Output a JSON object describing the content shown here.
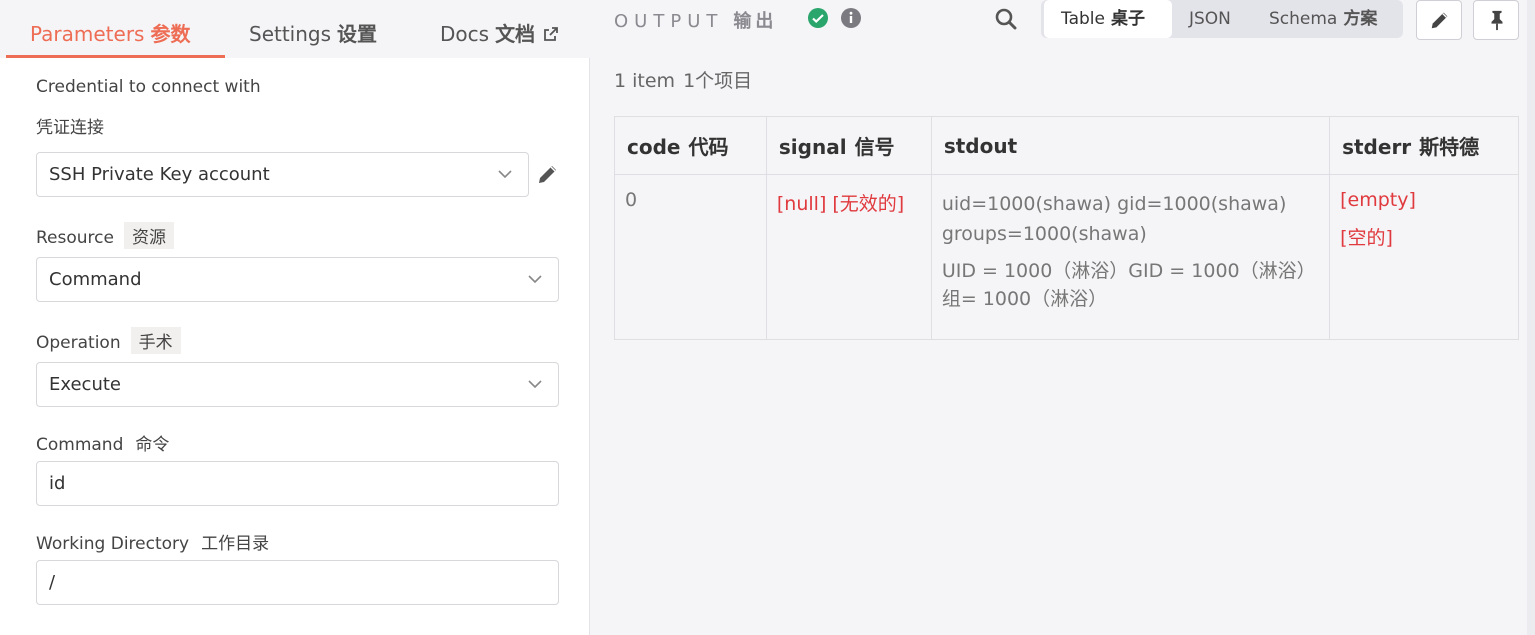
{
  "tabs": {
    "parameters": {
      "en": "Parameters",
      "zh": "参数"
    },
    "settings": {
      "en": "Settings",
      "zh": "设置"
    },
    "docs": {
      "en": "Docs",
      "zh": "文档"
    }
  },
  "form": {
    "credential": {
      "label_en": "Credential to connect with",
      "label_zh": "凭证连接",
      "value": "SSH Private Key account"
    },
    "resource": {
      "label_en": "Resource",
      "label_zh": "资源",
      "value": "Command"
    },
    "operation": {
      "label_en": "Operation",
      "label_zh": "手术",
      "value": "Execute"
    },
    "command": {
      "label_en": "Command",
      "label_zh": "命令",
      "value": "id"
    },
    "working_directory": {
      "label_en": "Working Directory",
      "label_zh": "工作目录",
      "value": "/"
    }
  },
  "output": {
    "title_en": "OUTPUT",
    "title_zh": "输出",
    "views": {
      "table": {
        "en": "Table",
        "zh": "桌子"
      },
      "json": {
        "en": "JSON"
      },
      "schema": {
        "en": "Schema",
        "zh": "方案"
      }
    },
    "count": {
      "en": "1 item",
      "zh": "1个项目"
    },
    "columns": [
      {
        "en": "code",
        "zh": "代码"
      },
      {
        "en": "signal",
        "zh": "信号"
      },
      {
        "en": "stdout",
        "zh": ""
      },
      {
        "en": "stderr",
        "zh": "斯特德"
      }
    ],
    "row": {
      "code": "0",
      "signal": "[null]  [无效的]",
      "stdout_en": "uid=1000(shawa) gid=1000(shawa) groups=1000(shawa)",
      "stdout_zh": "UID = 1000（淋浴）GID = 1000（淋浴）组= 1000（淋浴）",
      "stderr_en": "[empty]",
      "stderr_zh": "[空的]"
    }
  },
  "colors": {
    "accent": "#ee6d55",
    "success": "#2aa56b",
    "null_text": "#e0393e"
  }
}
